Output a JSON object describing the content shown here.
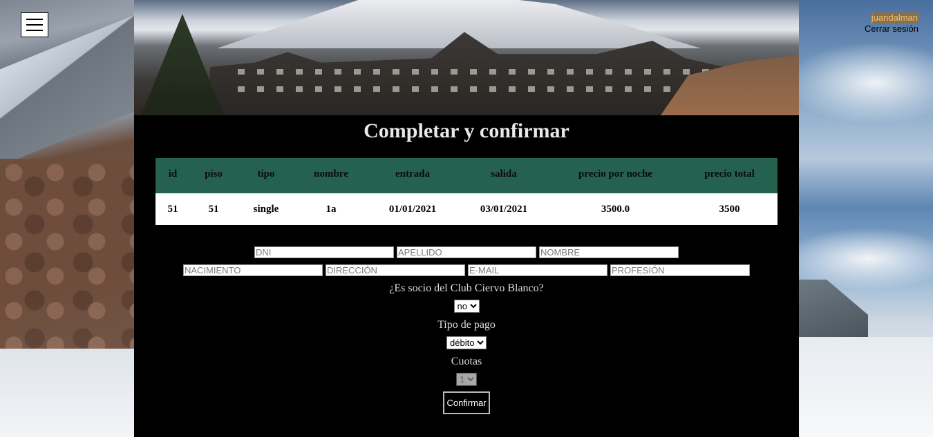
{
  "header": {
    "username": "juandalman",
    "logout_label": "Cerrar sesión"
  },
  "page": {
    "title": "Completar y confirmar"
  },
  "reservation_table": {
    "headers": [
      "id",
      "piso",
      "tipo",
      "nombre",
      "entrada",
      "salida",
      "precio por noche",
      "precio total"
    ],
    "row": [
      "51",
      "51",
      "single",
      "1a",
      "01/01/2021",
      "03/01/2021",
      "3500.0",
      "3500"
    ]
  },
  "form": {
    "dni_placeholder": "DNI",
    "apellido_placeholder": "APELLIDO",
    "nombre_placeholder": "NOMBRE",
    "nacimiento_placeholder": "NACIMIENTO",
    "direccion_placeholder": "DIRECCIÓN",
    "email_placeholder": "E-MAIL",
    "profesion_placeholder": "PROFESIÓN",
    "socio_label": "¿Es socio del Club Ciervo Blanco?",
    "socio_value": "no",
    "pago_label": "Tipo de pago",
    "pago_value": "débito",
    "cuotas_label": "Cuotas",
    "cuotas_value": "1",
    "confirm_label": "Confirmar"
  },
  "colors": {
    "table_header": "#25614f",
    "username_bg": "#8a6f4d",
    "username_text": "#f3c36b"
  }
}
